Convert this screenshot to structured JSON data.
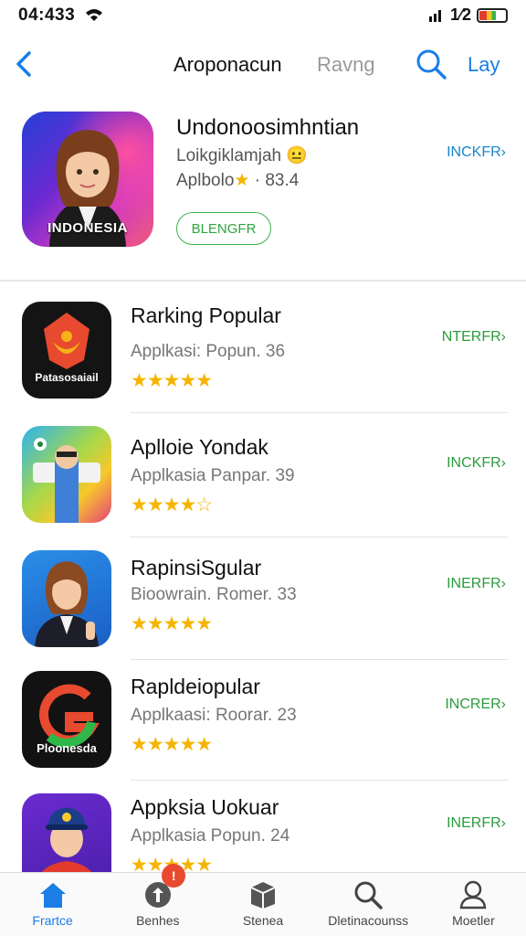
{
  "status_bar": {
    "time": "04:433",
    "network": "1⁄2"
  },
  "nav": {
    "title": "Aroponacun",
    "secondary_tab": "Ravng",
    "right_label": "Lay"
  },
  "featured": {
    "name": "Undonoosimhntian",
    "subtitle": "Loikgiklamjah",
    "meta_prefix": "Aplbolo",
    "meta_suffix": " · 83.4",
    "icon_label": "INDONESIA",
    "button_label": "BLENGFR",
    "action_label": "INCKFR›"
  },
  "apps": [
    {
      "name": "Rarking Popular",
      "meta": "Applkasi: Popun. 36",
      "stars": "★★★★★",
      "action": "NTERFR›",
      "icon_label": "Patasosaiail"
    },
    {
      "name": "Aplloie Yondak",
      "meta": "Applkasia Panpar. 39",
      "stars": "★★★★☆",
      "action": "INCKFR›",
      "icon_label": ""
    },
    {
      "name": "RapinsiSgular",
      "meta": "Bioowrain. Romer. 33",
      "stars": "★★★★★",
      "action": "INERFR›",
      "icon_label": ""
    },
    {
      "name": "Rapldeiopular",
      "meta": "Applkaasi: Roorar. 23",
      "stars": "★★★★★",
      "action": "INCRER›",
      "icon_label": "Ploonesda"
    },
    {
      "name": "Appksia Uokuar",
      "meta": "Applkasia Popun. 24",
      "stars": "★★★★★",
      "action": "INERFR›",
      "icon_label": ""
    }
  ],
  "tabbar": {
    "tabs": [
      {
        "label": "Frartce",
        "icon": "home-icon"
      },
      {
        "label": "Benhes",
        "icon": "apps-icon"
      },
      {
        "label": "Stenea",
        "icon": "games-icon"
      },
      {
        "label": "Dletinacounss",
        "icon": "search-icon"
      },
      {
        "label": "Moetler",
        "icon": "account-icon"
      }
    ],
    "badge": "!"
  },
  "colors": {
    "accent": "#1a7ee6",
    "green": "#2fa53d",
    "star": "#f5b400"
  }
}
